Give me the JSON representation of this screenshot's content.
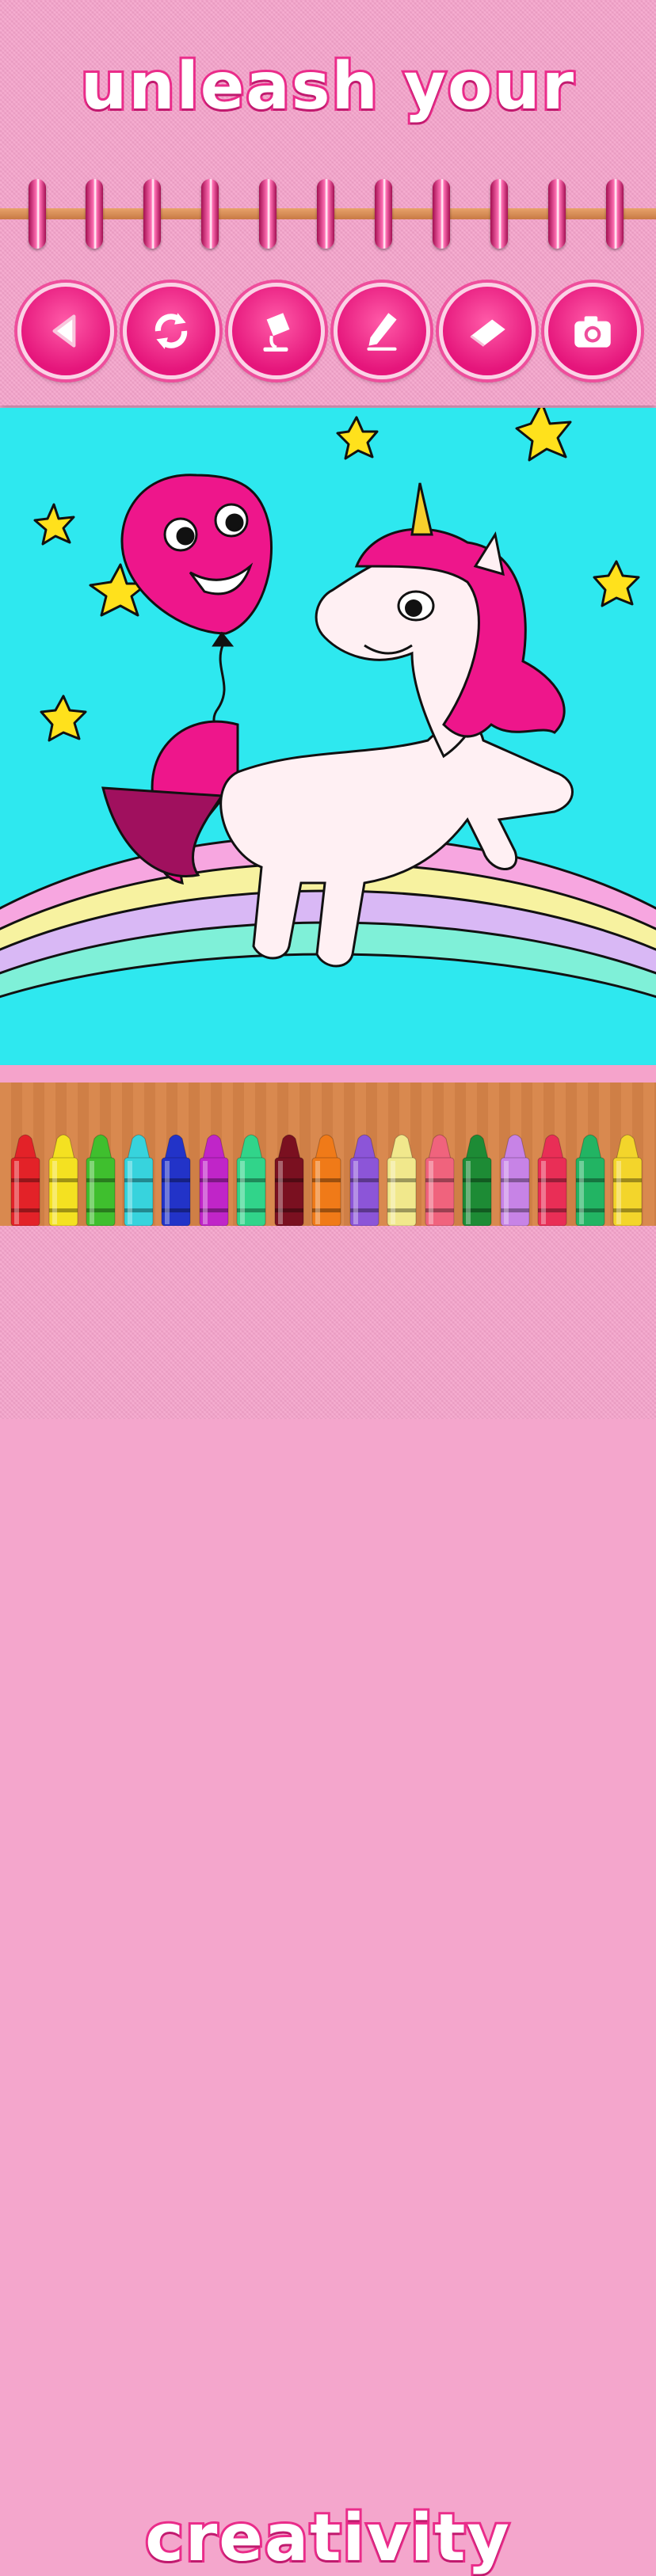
{
  "headline_top": "unleash your",
  "headline_bottom": "creativity",
  "toolbar": {
    "tools": [
      {
        "name": "back",
        "icon": "play-back-icon"
      },
      {
        "name": "undo",
        "icon": "refresh-arrows-icon"
      },
      {
        "name": "fill",
        "icon": "paint-bucket-icon"
      },
      {
        "name": "pencil",
        "icon": "pencil-icon"
      },
      {
        "name": "eraser",
        "icon": "eraser-icon"
      },
      {
        "name": "camera",
        "icon": "camera-icon"
      }
    ]
  },
  "crayons": {
    "colors": [
      "#e32228",
      "#f4e121",
      "#3fbf2e",
      "#37d3dd",
      "#2233c8",
      "#c025c8",
      "#31d48a",
      "#7a1020",
      "#f07a18",
      "#8c55d8",
      "#f1e88c",
      "#f0637d",
      "#1d8b35",
      "#c783e6",
      "#e92e56",
      "#22b463",
      "#f3d52b"
    ]
  },
  "colors": {
    "accent": "#ea2c8a",
    "panel": "#f5a3cb",
    "canvas_bg": "#2ee8ef"
  }
}
